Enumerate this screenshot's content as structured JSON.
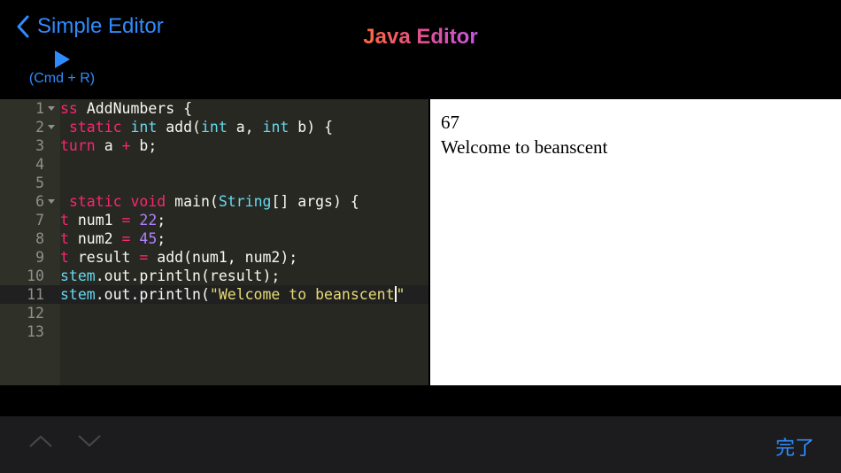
{
  "nav": {
    "back_label": "Simple Editor",
    "title": "Java Editor",
    "run_shortcut": "(Cmd + R)"
  },
  "editor": {
    "lines": [
      {
        "num": "1",
        "fold": true
      },
      {
        "num": "2",
        "fold": true
      },
      {
        "num": "3"
      },
      {
        "num": "4"
      },
      {
        "num": "5"
      },
      {
        "num": "6",
        "fold": true
      },
      {
        "num": "7"
      },
      {
        "num": "8"
      },
      {
        "num": "9"
      },
      {
        "num": "10"
      },
      {
        "num": "11",
        "active": true
      },
      {
        "num": "12"
      },
      {
        "num": "13"
      }
    ],
    "code": {
      "l1": [
        "ss ",
        "AddNumbers {"
      ],
      "l2": [
        "static",
        "int",
        "add(",
        "int",
        "a, ",
        "int",
        "b) {"
      ],
      "l3": [
        "turn",
        "a ",
        "+",
        " b;"
      ],
      "l6": [
        "static",
        "void",
        "main(",
        "String",
        "[] args) {"
      ],
      "l7": [
        "t",
        " num1 ",
        "=",
        "22",
        ";"
      ],
      "l8": [
        "t",
        " num2 ",
        "=",
        "45",
        ";"
      ],
      "l9": [
        "t",
        " result ",
        "=",
        " add(num1, num2);"
      ],
      "l10": [
        "stem",
        ".out.println(result);"
      ],
      "l11": [
        "stem",
        ".out.println(",
        "\"Welcome to beanscent",
        "\""
      ]
    }
  },
  "output": {
    "lines": [
      "67",
      "Welcome to beanscent"
    ]
  },
  "toolbar": {
    "done_label": "完了"
  },
  "colors": {
    "accent": "#2f8cff",
    "editor_bg": "#272822",
    "gutter_bg": "#2f3129",
    "keyword": "#f92672",
    "type": "#66d9ef",
    "number": "#ae81ff",
    "string": "#e6db74"
  }
}
